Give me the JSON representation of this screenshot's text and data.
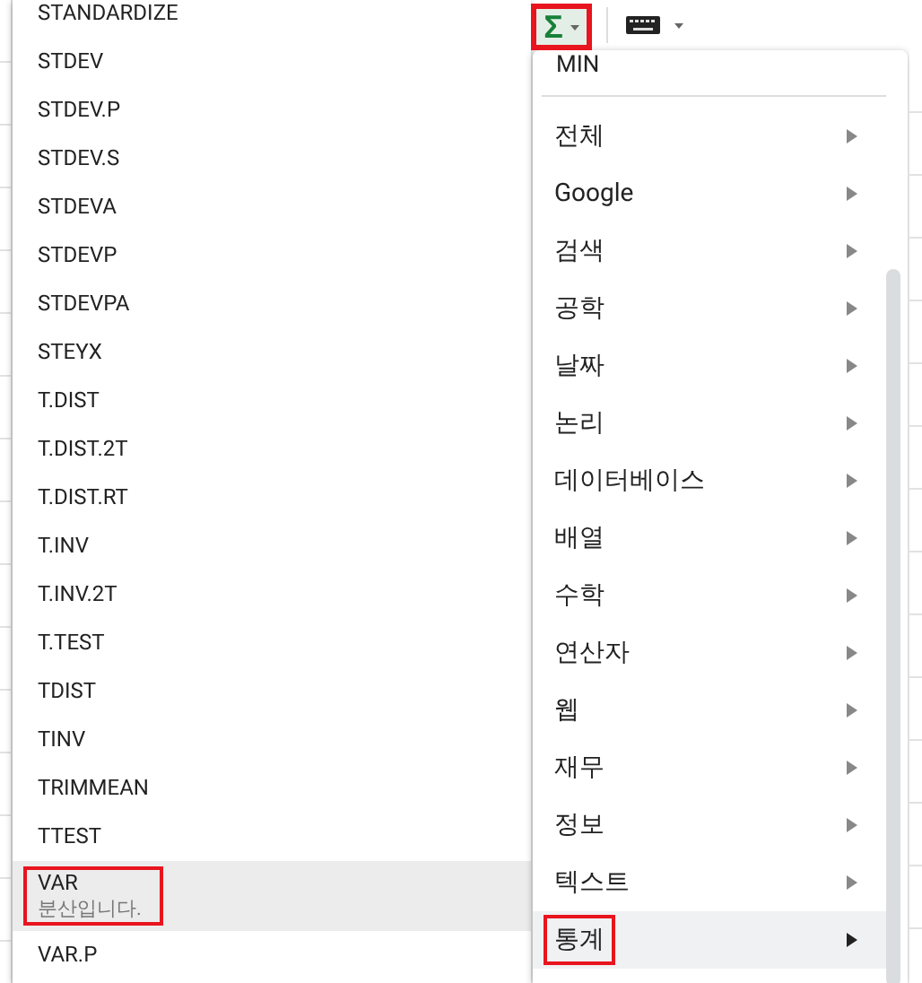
{
  "toolbar": {
    "function_button": {
      "symbol": "Σ",
      "marked": true
    }
  },
  "function_list": [
    {
      "name": "STANDARDIZE",
      "selected": false,
      "marked": false
    },
    {
      "name": "STDEV",
      "selected": false,
      "marked": false
    },
    {
      "name": "STDEV.P",
      "selected": false,
      "marked": false
    },
    {
      "name": "STDEV.S",
      "selected": false,
      "marked": false
    },
    {
      "name": "STDEVA",
      "selected": false,
      "marked": false
    },
    {
      "name": "STDEVP",
      "selected": false,
      "marked": false
    },
    {
      "name": "STDEVPA",
      "selected": false,
      "marked": false
    },
    {
      "name": "STEYX",
      "selected": false,
      "marked": false
    },
    {
      "name": "T.DIST",
      "selected": false,
      "marked": false
    },
    {
      "name": "T.DIST.2T",
      "selected": false,
      "marked": false
    },
    {
      "name": "T.DIST.RT",
      "selected": false,
      "marked": false
    },
    {
      "name": "T.INV",
      "selected": false,
      "marked": false
    },
    {
      "name": "T.INV.2T",
      "selected": false,
      "marked": false
    },
    {
      "name": "T.TEST",
      "selected": false,
      "marked": false
    },
    {
      "name": "TDIST",
      "selected": false,
      "marked": false
    },
    {
      "name": "TINV",
      "selected": false,
      "marked": false
    },
    {
      "name": "TRIMMEAN",
      "selected": false,
      "marked": false
    },
    {
      "name": "TTEST",
      "selected": false,
      "marked": false
    },
    {
      "name": "VAR",
      "description": "분산입니다.",
      "selected": true,
      "marked": true
    },
    {
      "name": "VAR.P",
      "selected": false,
      "marked": false
    }
  ],
  "function_menu": {
    "top_item": "MIN",
    "categories": [
      {
        "label": "전체",
        "selected": false,
        "marked": false
      },
      {
        "label": "Google",
        "selected": false,
        "marked": false
      },
      {
        "label": "검색",
        "selected": false,
        "marked": false
      },
      {
        "label": "공학",
        "selected": false,
        "marked": false
      },
      {
        "label": "날짜",
        "selected": false,
        "marked": false
      },
      {
        "label": "논리",
        "selected": false,
        "marked": false
      },
      {
        "label": "데이터베이스",
        "selected": false,
        "marked": false
      },
      {
        "label": "배열",
        "selected": false,
        "marked": false
      },
      {
        "label": "수학",
        "selected": false,
        "marked": false
      },
      {
        "label": "연산자",
        "selected": false,
        "marked": false
      },
      {
        "label": "웹",
        "selected": false,
        "marked": false
      },
      {
        "label": "재무",
        "selected": false,
        "marked": false
      },
      {
        "label": "정보",
        "selected": false,
        "marked": false
      },
      {
        "label": "텍스트",
        "selected": false,
        "marked": false
      },
      {
        "label": "통계",
        "selected": true,
        "marked": true
      }
    ]
  }
}
